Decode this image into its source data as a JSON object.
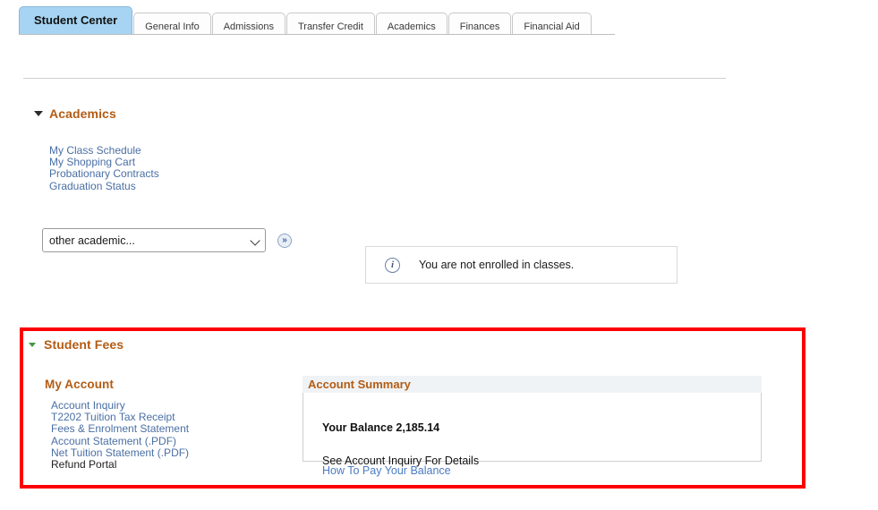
{
  "tabs": [
    {
      "label": "Student Center",
      "active": true
    },
    {
      "label": "General Info",
      "active": false
    },
    {
      "label": "Admissions",
      "active": false
    },
    {
      "label": "Transfer Credit",
      "active": false
    },
    {
      "label": "Academics",
      "active": false
    },
    {
      "label": "Finances",
      "active": false
    },
    {
      "label": "Financial Aid",
      "active": false
    }
  ],
  "academics": {
    "title": "Academics",
    "toggle_icon": "triangle-down-icon",
    "links": [
      "My Class Schedule",
      "My Shopping Cart",
      "Probationary Contracts",
      "Graduation Status"
    ],
    "dropdown": {
      "value": "other academic...",
      "options": [
        "other academic..."
      ],
      "chevron_icon": "chevron-down-icon"
    },
    "go_button": {
      "label": "»",
      "icon": "double-chevron-right-icon"
    },
    "message": {
      "icon": "info-circle-icon",
      "text": "You are not enrolled in classes."
    }
  },
  "student_fees": {
    "title": "Student Fees",
    "toggle_icon": "triangle-down-green-icon",
    "my_account": {
      "title": "My Account",
      "links": [
        {
          "label": "Account Inquiry",
          "is_link": true
        },
        {
          "label": "T2202 Tuition Tax Receipt",
          "is_link": true
        },
        {
          "label": "Fees & Enrolment Statement",
          "is_link": true
        },
        {
          "label": "Account Statement (.PDF)",
          "is_link": true
        },
        {
          "label": "Net Tuition Statement (.PDF)",
          "is_link": true
        },
        {
          "label": "Refund Portal",
          "is_link": false
        }
      ]
    },
    "account_summary": {
      "title": "Account Summary",
      "balance_label": "Your Balance",
      "balance_value": "2,185.14",
      "balance_line": "Your Balance 2,185.14",
      "details_note": "See Account Inquiry For Details",
      "pay_link": "How To Pay Your Balance"
    }
  },
  "colors": {
    "active_tab": "#a6d4f2",
    "section_heading": "#b35c14",
    "link": "#4a6fa5",
    "highlight_box": "#fc0000",
    "summary_header_bg": "#f0f3f5"
  }
}
